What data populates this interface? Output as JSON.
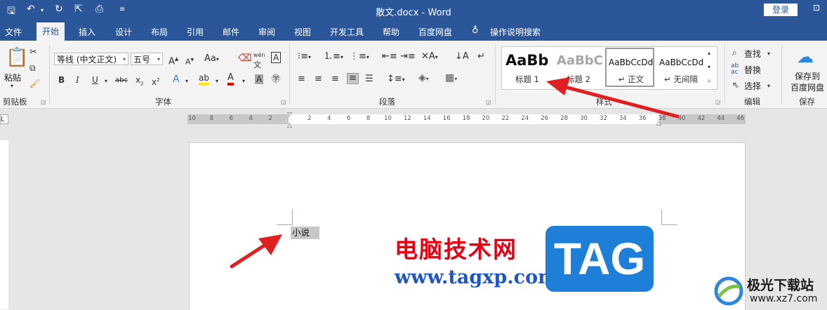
{
  "window": {
    "title": "散文.docx  -  Word",
    "login_label": "登录"
  },
  "tabs": [
    "文件",
    "开始",
    "插入",
    "设计",
    "布局",
    "引用",
    "邮件",
    "审阅",
    "视图",
    "开发工具",
    "帮助",
    "百度网盘"
  ],
  "active_tab": "开始",
  "tell_me": "操作说明搜索",
  "ribbon": {
    "clipboard": {
      "paste_label": "粘贴",
      "group_label": "剪贴板"
    },
    "font": {
      "font_name": "等线 (中文正文)",
      "font_size": "五号",
      "group_label": "字体",
      "phonetic_top": "wén",
      "phonetic_bottom": "文"
    },
    "paragraph": {
      "group_label": "段落"
    },
    "styles": {
      "group_label": "样式",
      "items": [
        {
          "sample": "AaBb",
          "name": "标题 1"
        },
        {
          "sample": "AaBbC",
          "name": "标题 2"
        },
        {
          "sample": "AaBbCcDd",
          "name": "↵ 正文"
        },
        {
          "sample": "AaBbCcDd",
          "name": "↵ 无间隔"
        }
      ]
    },
    "editing": {
      "find_label": "查找",
      "replace_label": "替换",
      "select_label": "选择",
      "group_label": "编辑"
    },
    "save": {
      "save_label_line1": "保存到",
      "save_label_line2": "百度网盘",
      "group_label": "保存"
    }
  },
  "ruler": {
    "left_ticks": [
      "10",
      "8",
      "6",
      "4",
      "2"
    ],
    "right_ticks": [
      "2",
      "4",
      "6",
      "8",
      "10",
      "12",
      "14",
      "16",
      "18",
      "20",
      "22",
      "24",
      "26",
      "28",
      "30",
      "32",
      "34",
      "36",
      "38",
      "40",
      "42",
      "44",
      "46"
    ]
  },
  "document": {
    "text": "小说"
  },
  "watermark": {
    "chinese": "电脑技术网",
    "url": "www.tagxp.com",
    "tag": "TAG",
    "site_name": "极光下载站",
    "site_url": "www.xz7.com"
  },
  "colors": {
    "word_blue": "#2b579a",
    "annotation_red": "#e02020",
    "watermark_red": "#e60012",
    "watermark_blue": "#1d7fd8"
  }
}
